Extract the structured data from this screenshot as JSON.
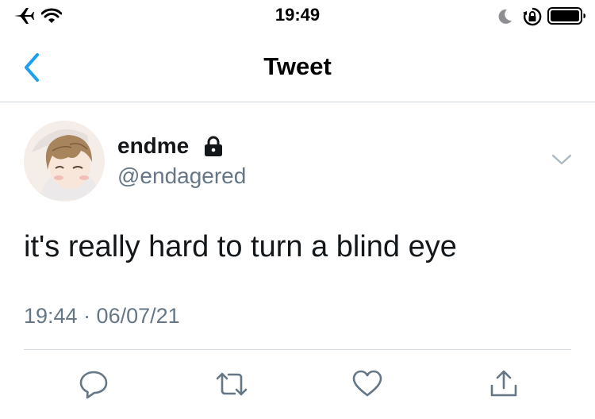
{
  "status_bar": {
    "time": "19:49",
    "icons": [
      "airplane-icon",
      "wifi-icon",
      "moon-icon",
      "rotation-lock-icon",
      "battery-icon"
    ]
  },
  "nav": {
    "title": "Tweet",
    "back_icon": "chevron-left-icon"
  },
  "tweet": {
    "author": {
      "display_name": "endme",
      "handle": "@endagered",
      "protected": true
    },
    "text": "it's really hard to turn a blind eye",
    "timestamp": "19:44 · 06/07/21",
    "actions": [
      "reply-icon",
      "retweet-icon",
      "like-icon",
      "share-icon"
    ]
  },
  "colors": {
    "accent": "#1da1f2",
    "text": "#14171a",
    "secondary_text": "#657786",
    "divider": "#cfd4d9"
  }
}
